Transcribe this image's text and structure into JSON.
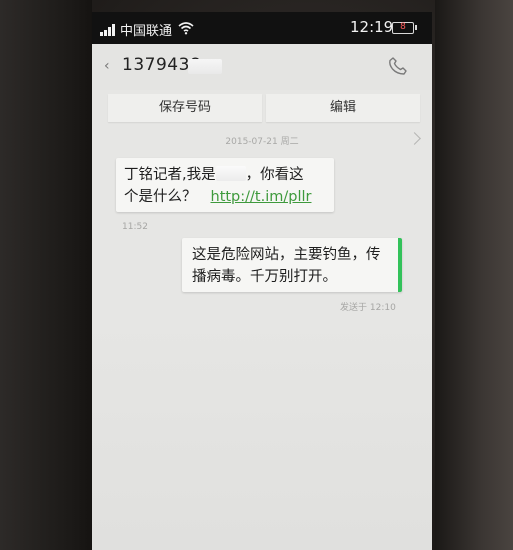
{
  "status_bar": {
    "carrier": "中国联通",
    "time": "12:19",
    "battery": "8"
  },
  "header": {
    "contact_number": "1379438"
  },
  "actions": {
    "save_number": "保存号码",
    "edit": "编辑"
  },
  "conversation": {
    "date": "2015-07-21 周二",
    "incoming": {
      "line1_prefix": "丁铭记者,我是",
      "line1_suffix": "，你看这",
      "line2_text": "个是什么？",
      "link": "http://t.im/pllr",
      "time": "11:52"
    },
    "outgoing": {
      "line1": "这是危险网站，主要钓鱼，传",
      "line2": "播病毒。千万别打开。",
      "status": "发送于 12:10"
    }
  },
  "colors": {
    "link": "#3e9a3c",
    "sent_indicator": "#33c25a",
    "status_bar": "#111111",
    "screen_background": "#e6e6e4"
  },
  "icons": {
    "back": "back-arrow-icon",
    "call": "phone-icon",
    "signal": "signal-icon",
    "wifi": "wifi-icon",
    "battery": "battery-icon"
  }
}
